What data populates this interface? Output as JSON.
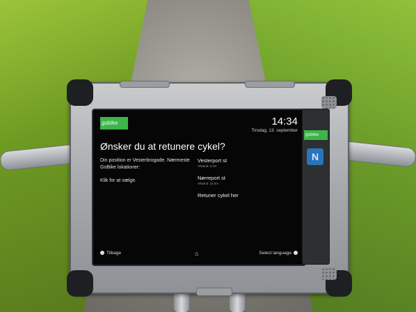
{
  "brand": {
    "logo_text": "gobike",
    "side_logo_text": "gobike",
    "color": "#3db54a"
  },
  "clock": {
    "time": "14:34",
    "date": "Tirsdag, 13. september"
  },
  "question": "Ønsker du at retunere cykel?",
  "position_text": "Din position er Vesterbrogade. Nærmeste GoBike lokationer:",
  "instruction": "Klik for at vælge.",
  "locations": [
    {
      "name": "Vesterport st",
      "distance": "Afstand: 5 km"
    },
    {
      "name": "Nørreport st",
      "distance": "Afstand: 32 km"
    }
  ],
  "return_label": "Retuner cykel her",
  "footer": {
    "back_label": "Tilbage",
    "language_label": "Select language",
    "home_icon": "home-icon"
  },
  "nfc_icon": "nfc-icon"
}
